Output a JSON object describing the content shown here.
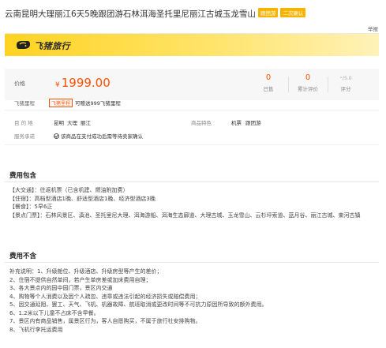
{
  "header": {
    "title": "云南昆明大理丽江6天5晚跟团游石林洱海圣托里尼丽江古城玉龙雪山",
    "tags": [
      {
        "label": "跟团游",
        "color": "#f5b400"
      },
      {
        "label": "二次确认",
        "color": "#f5b400"
      }
    ],
    "report_label": "举报"
  },
  "brand": {
    "logo_text": "飞猪旅行",
    "logo_icon": "fliggy-pig-icon",
    "bar_color": "#ffd321"
  },
  "price_panel": {
    "price_label": "价格",
    "currency": "¥",
    "price": "1999.00",
    "price_color": "#ff5000",
    "stats": [
      {
        "value": "0",
        "label": "已售"
      },
      {
        "value": "0",
        "label": "累计评价"
      }
    ],
    "score": {
      "value": "-",
      "max": "/5.0",
      "label": "评分"
    }
  },
  "mileage": {
    "label": "飞猪里程",
    "tag": "飞猪里程",
    "text": "可赠送999飞猪里程"
  },
  "info": {
    "destination_label": "目 的 地",
    "destinations": [
      "昆明",
      "大理",
      "丽江"
    ],
    "features_label": "商品特色",
    "features": [
      "机票",
      "跟团游"
    ],
    "service_label": "服务承诺",
    "service_icon": "check-circle-icon",
    "service_text": "该商品在支付成功后需等待卖家确认"
  },
  "included": {
    "title": "费用包含",
    "lines": [
      "【大交通】：往返机票（已含机建、燃油附加费）",
      "【住宿】：高档型酒店1晚、舒适型酒店1晚、经济型酒店3晚",
      "【餐食】：5早6正",
      "【景点门票】：石林风景区、滇池、圣托里尼大理、洱海游船、洱海生态廊道、大理古城、玉龙雪山、云杉坪索道、蓝月谷、丽江古城、束河古镇"
    ]
  },
  "excluded": {
    "title": "费用不含",
    "lines": [
      "补充说明：1、升级舱位、升级酒店、升级房型等产生的差价；",
      "2、住宿不提供自然单间，若产生单房差或加床费用自理；",
      "3、各大景点内的园中园门票，景区内交通",
      "4、购物等个人消费以及因个人疏忽、违章或违法引起的经济损失或赔偿费用；",
      "5、因交通延阻、罢工、天气、飞机、机器故障、航班取消或更改时间等不可抗力原因所导致的额外费用。",
      "6、1.2米以下儿童不占床不含早餐。",
      "7、景区内有商品销售，属景区行为，客人自愿购买，不属于旅行社安排购物。",
      "8、飞机行李托运费用"
    ]
  }
}
